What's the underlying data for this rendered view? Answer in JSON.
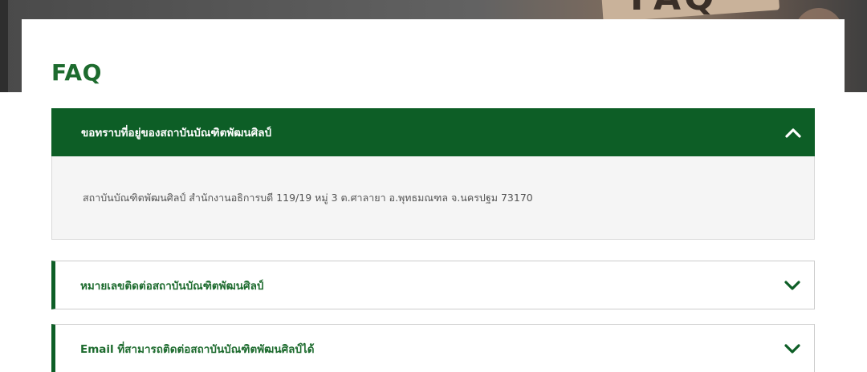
{
  "hero": {
    "banner_text": "FAQ"
  },
  "page": {
    "title": "FAQ"
  },
  "faq": {
    "items": [
      {
        "question": "ขอทราบที่อยู่ของสถาบันบัณฑิตพัฒนศิลป์",
        "answer": "สถาบันบัณฑิตพัฒนศิลป์ สำนักงานอธิการบดี 119/19 หมู่ 3 ต.ศาลายา อ.พุทธมณฑล จ.นครปฐม 73170",
        "expanded": true
      },
      {
        "question": "หมายเลขติดต่อสถาบันบัณฑิตพัฒนศิลป์",
        "expanded": false
      },
      {
        "question": "Email ที่สามารถติดต่อสถาบันบัณฑิตพัฒนศิลป์ได้",
        "expanded": false
      }
    ]
  },
  "colors": {
    "brand_green": "#0d5e26",
    "title_green": "#1d6b2e",
    "answer_bg": "#f5f5f5"
  },
  "icons": {
    "expanded": "chevron-up-icon",
    "collapsed": "chevron-down-icon"
  }
}
